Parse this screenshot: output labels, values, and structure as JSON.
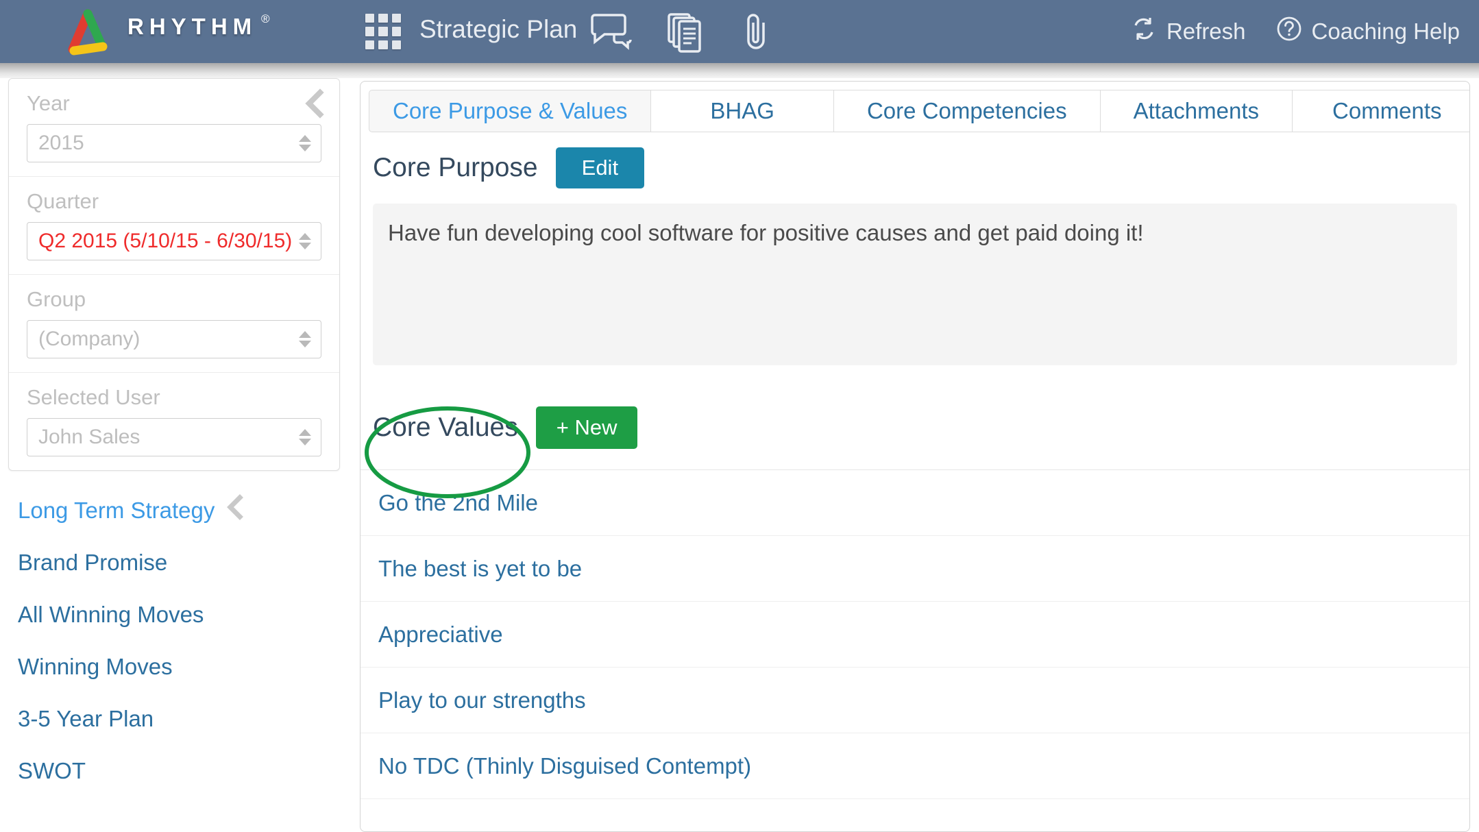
{
  "header": {
    "brand": "RHYTHM",
    "brand_mark": "®",
    "app_title": "Strategic Plan",
    "grid_icon": "app-grid-icon",
    "icons": [
      {
        "name": "comments-icon",
        "label": "Comments"
      },
      {
        "name": "documents-icon",
        "label": "Documents"
      },
      {
        "name": "attachment-icon",
        "label": "Attachments"
      }
    ],
    "refresh_label": "Refresh",
    "help_label": "Coaching Help",
    "bg_color": "#5a7292"
  },
  "sidebar": {
    "collapse_icon": "chevron-left-icon",
    "filters": [
      {
        "label": "Year",
        "value": "2015",
        "value_color": "#bdbdbd"
      },
      {
        "label": "Quarter",
        "value": "Q2 2015 (5/10/15 - 6/30/15)",
        "value_color": "#ef2b2b"
      },
      {
        "label": "Group",
        "value": "(Company)",
        "value_color": "#bdbdbd"
      },
      {
        "label": "Selected User",
        "value": "John Sales",
        "value_color": "#bdbdbd"
      }
    ],
    "nav": [
      {
        "label": "Long Term Strategy",
        "active": true
      },
      {
        "label": "Brand Promise",
        "active": false
      },
      {
        "label": "All Winning Moves",
        "active": false
      },
      {
        "label": "Winning Moves",
        "active": false
      },
      {
        "label": "3-5 Year Plan",
        "active": false
      },
      {
        "label": "SWOT",
        "active": false
      }
    ]
  },
  "main": {
    "tabs": [
      {
        "label": "Core Purpose & Values",
        "active": true
      },
      {
        "label": "BHAG",
        "active": false
      },
      {
        "label": "Core Competencies",
        "active": false
      },
      {
        "label": "Attachments",
        "active": false
      },
      {
        "label": "Comments",
        "active": false
      }
    ],
    "core_purpose": {
      "title": "Core Purpose",
      "edit_label": "Edit",
      "text": "Have fun developing cool software for positive causes and get paid doing it!"
    },
    "core_values": {
      "title": "Core Values",
      "new_label": "+ New",
      "items": [
        "Go the 2nd Mile",
        "The best is yet to be",
        "Appreciative",
        "Play to our strengths",
        "No TDC (Thinly Disguised Contempt)"
      ]
    }
  },
  "annotation": {
    "shape": "ellipse",
    "color": "#169b43",
    "target": "Core Values"
  }
}
